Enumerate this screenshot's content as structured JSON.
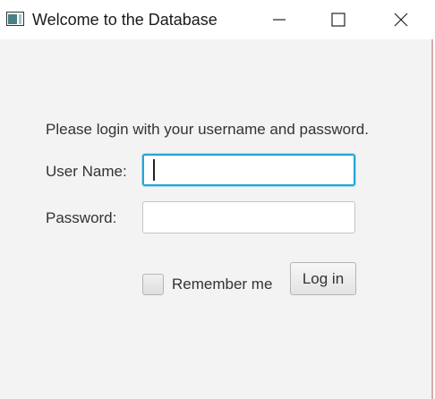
{
  "window": {
    "title": "Welcome to the Database",
    "controls": {
      "minimize_icon": "minimize-icon",
      "maximize_icon": "maximize-icon",
      "close_icon": "close-icon"
    }
  },
  "form": {
    "prompt": "Please login with your username and password.",
    "username_label": "User Name:",
    "username_value": "",
    "password_label": "Password:",
    "password_value": "",
    "remember_label": "Remember me",
    "remember_checked": false,
    "login_label": "Log in"
  },
  "colors": {
    "focus_border": "#27a4d6",
    "background": "#f3f3f3"
  }
}
